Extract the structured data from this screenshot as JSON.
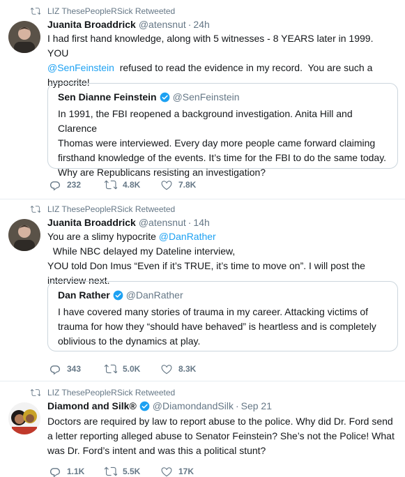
{
  "tweets": [
    {
      "retweet_label": "LIZ ThesePeopleRSick Retweeted",
      "author": {
        "name": "Juanita Broaddrick",
        "handle": "@atensnut",
        "time": "24h",
        "verified": false
      },
      "body": {
        "parts": [
          "I had first hand knowledge, along with 5 witnesses - 8 YEARS later in 1999. YOU",
          "@SenFeinstein",
          "  refused to read the evidence in my record.  You are such a",
          "hypocrite!"
        ]
      },
      "quote": {
        "name": "Sen Dianne Feinstein",
        "handle": "@SenFeinstein",
        "verified": true,
        "lines": [
          "In 1991, the FBI reopened a background investigation. Anita Hill and Clarence",
          "Thomas were interviewed. Every day more people came forward claiming",
          "firsthand knowledge of the events. It’s time for the FBI to do the same today.",
          "Why are Republicans resisting an investigation?"
        ]
      },
      "stats": {
        "replies": "232",
        "retweets": "4.8K",
        "likes": "7.8K"
      }
    },
    {
      "retweet_label": "LIZ ThesePeopleRSick Retweeted",
      "author": {
        "name": "Juanita Broaddrick",
        "handle": "@atensnut",
        "time": "14h",
        "verified": false
      },
      "body": {
        "parts": [
          "You are a slimy hypocrite",
          "@DanRather",
          "  While NBC delayed my Dateline interview,",
          "YOU told Don Imus “Even if it’s TRUE, it’s time to move on”.  I will post the",
          "interview next."
        ]
      },
      "quote": {
        "name": "Dan Rather",
        "handle": "@DanRather",
        "verified": true,
        "lines": [
          "I have covered many stories of trauma in my career. Attacking victims of",
          "trauma for how they “should have behaved” is heartless and is completely",
          "oblivious to the dynamics at play."
        ]
      },
      "stats": {
        "replies": "343",
        "retweets": "5.0K",
        "likes": "8.3K"
      }
    },
    {
      "retweet_label": "LIZ ThesePeopleRSick Retweeted",
      "author": {
        "name": "Diamond and Silk®",
        "handle": "@DiamondandSilk",
        "time": "Sep 21",
        "verified": true
      },
      "body": {
        "lines": [
          "Doctors are required by law to report abuse to the police.  Why did Dr. Ford send",
          "a letter reporting alleged abuse to Senator Feinstein? She’s not the Police!  What",
          "was Dr. Ford’s intent and was this a political stunt?"
        ]
      },
      "stats": {
        "replies": "1.1K",
        "retweets": "5.5K",
        "likes": "17K"
      }
    }
  ],
  "icons": {
    "retweet": "retweet-icon",
    "reply": "reply-icon",
    "like": "like-icon",
    "verified": "verified-badge-icon"
  },
  "colors": {
    "accent": "#1da1f2",
    "secondary_text": "#657786",
    "border": "#ccd6dd"
  }
}
